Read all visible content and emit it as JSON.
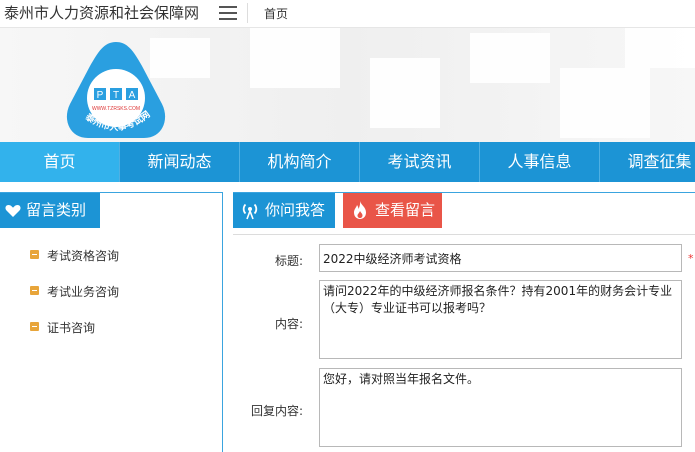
{
  "header": {
    "site_title": "泰州市人力资源和社会保障网",
    "menu_icon": "hamburger-icon",
    "home_link": "首页"
  },
  "logo": {
    "letters": [
      "P",
      "T",
      "A"
    ],
    "url_text": "WWW.TZRSKS.COM",
    "arc_text": "泰州市人事考试网",
    "color": "#2a9fe0"
  },
  "nav": {
    "items": [
      {
        "label": "首页",
        "active": true
      },
      {
        "label": "新闻动态",
        "active": false
      },
      {
        "label": "机构简介",
        "active": false
      },
      {
        "label": "考试资讯",
        "active": false
      },
      {
        "label": "人事信息",
        "active": false
      },
      {
        "label": "调查征集",
        "active": false
      }
    ]
  },
  "sidebar": {
    "title": "留言类别",
    "title_icon": "heart-icon",
    "items": [
      "考试资格咨询",
      "考试业务咨询",
      "证书咨询"
    ]
  },
  "main": {
    "tabs": [
      {
        "label": "你问我答",
        "icon": "broadcast-icon"
      },
      {
        "label": "查看留言",
        "icon": "flame-icon"
      }
    ],
    "form": {
      "title_label": "标题:",
      "title_value": "2022中级经济师考试资格",
      "required_mark": "*",
      "content_label": "内容:",
      "content_value": "请问2022年的中级经济师报名条件？持有2001年的财务会计专业（大专）专业证书可以报考吗？",
      "reply_label": "回复内容:",
      "reply_value": "您好，请对照当年报名文件。"
    }
  },
  "colors": {
    "nav_bg": "#1c94d5",
    "nav_active": "#32b2ec",
    "tab_red": "#e95548",
    "bullet": "#e8a53a"
  }
}
